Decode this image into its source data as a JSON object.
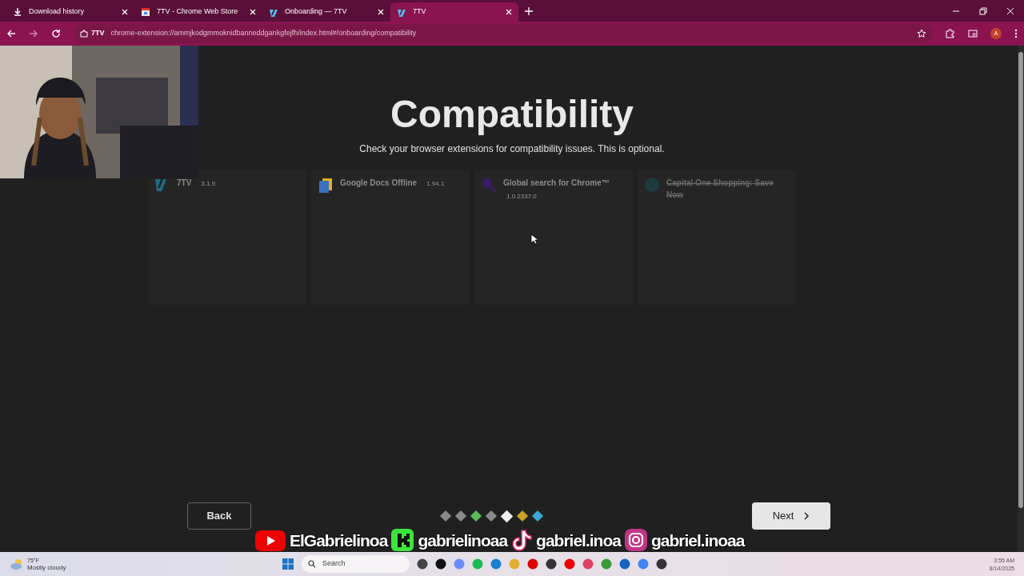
{
  "tabs": [
    {
      "title": "Download history",
      "selected": false
    },
    {
      "title": "7TV - Chrome Web Store",
      "selected": false
    },
    {
      "title": "Onboarding — 7TV",
      "selected": false
    },
    {
      "title": "7TV",
      "selected": true
    }
  ],
  "toolbar": {
    "site_label": "7TV",
    "url": "chrome-extension://ammjkodgmmoknidbanneddgankgfejfh/index.html#/onboarding/compatibility",
    "profile_initial": "A"
  },
  "page": {
    "title": "Compatibility",
    "subtitle": "Check your browser extensions for compatibility issues. This is optional.",
    "extensions": [
      {
        "name": "7TV",
        "version": "3.1.9",
        "disabled": false
      },
      {
        "name": "Google Docs Offline",
        "version": "1.94.1",
        "disabled": false
      },
      {
        "name": "Global search for Chrome™",
        "version": "1.0.2337.0",
        "disabled": false
      },
      {
        "name": "Capital One Shopping: Save Now",
        "disabled": true
      }
    ],
    "back_button": "Back",
    "next_button": "Next",
    "steps": [
      {
        "color": "#8a8a8a",
        "selected": false
      },
      {
        "color": "#8a8a8a",
        "selected": false
      },
      {
        "color": "#5bb85b",
        "selected": false
      },
      {
        "color": "#8a8a8a",
        "selected": false
      },
      {
        "color": "#f2f2f2",
        "selected": true
      },
      {
        "color": "#c9a227",
        "selected": false
      },
      {
        "color": "#3aa7d8",
        "selected": false
      }
    ]
  },
  "overlay": {
    "handles": [
      "ElGabrielinoa",
      "gabrielinoaa",
      "gabriel.inoa",
      "gabriel.inoaa"
    ]
  },
  "taskbar": {
    "temperature": "75°F",
    "weather": "Mostly cloudy",
    "search_placeholder": "Search",
    "time": "3:55 AM",
    "date": "8/14/2025"
  }
}
